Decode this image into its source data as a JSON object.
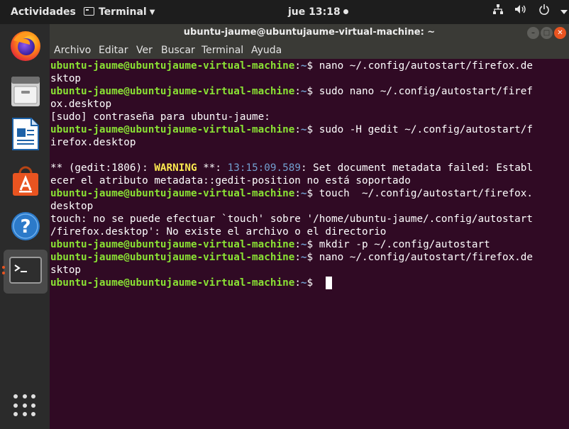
{
  "topbar": {
    "activities": "Actividades",
    "app_menu": "Terminal",
    "clock": "jue 13:18"
  },
  "dock": {
    "apps": [
      {
        "name": "Firefox"
      },
      {
        "name": "Archivos"
      },
      {
        "name": "LibreOffice Writer"
      },
      {
        "name": "Ubuntu Software"
      },
      {
        "name": "Ayuda"
      },
      {
        "name": "Terminal"
      }
    ]
  },
  "window": {
    "title": "ubuntu-jaume@ubuntujaume-virtual-machine: ~",
    "menu": [
      "Archivo",
      "Editar",
      "Ver",
      "Buscar",
      "Terminal",
      "Ayuda"
    ]
  },
  "terminal": {
    "prompt_user": "ubuntu-jaume@ubuntujaume-virtual-machine",
    "prompt_path": "~",
    "lines": [
      {
        "type": "prompt",
        "cmd": " nano ~/.config/autostart/firefox.de"
      },
      {
        "type": "text",
        "text": "sktop"
      },
      {
        "type": "prompt",
        "cmd": " sudo nano ~/.config/autostart/firef"
      },
      {
        "type": "text",
        "text": "ox.desktop"
      },
      {
        "type": "text",
        "text": "[sudo] contraseña para ubuntu-jaume:"
      },
      {
        "type": "prompt",
        "cmd": " sudo -H gedit ~/.config/autostart/f"
      },
      {
        "type": "text",
        "text": "irefox.desktop"
      },
      {
        "type": "text",
        "text": ""
      },
      {
        "type": "warning",
        "pre": "** (gedit:1806): ",
        "warn": "WARNING",
        "mid": " **: ",
        "time": "13:15:09.589",
        "post": ": Set document metadata failed: Establ"
      },
      {
        "type": "text",
        "text": "ecer el atributo metadata::gedit-position no está soportado"
      },
      {
        "type": "prompt",
        "cmd": " touch  ~/.config/autostart/firefox."
      },
      {
        "type": "text",
        "text": "desktop"
      },
      {
        "type": "text",
        "text": "touch: no se puede efectuar `touch' sobre '/home/ubuntu-jaume/.config/autostart"
      },
      {
        "type": "text",
        "text": "/firefox.desktop': No existe el archivo o el directorio"
      },
      {
        "type": "prompt",
        "cmd": " mkdir -p ~/.config/autostart"
      },
      {
        "type": "prompt",
        "cmd": " nano ~/.config/autostart/firefox.de"
      },
      {
        "type": "text",
        "text": "sktop"
      },
      {
        "type": "prompt",
        "cmd": " ",
        "cursor": true
      }
    ]
  }
}
